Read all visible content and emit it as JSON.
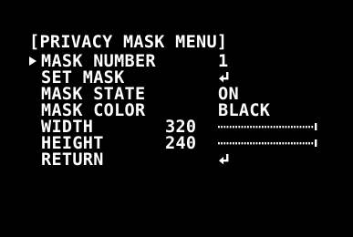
{
  "menu": {
    "title": "[PRIVACY MASK MENU]",
    "cursor_icon": "right-triangle-icon",
    "items": [
      {
        "label": "MASK NUMBER",
        "value": "1"
      },
      {
        "label": "SET MASK",
        "icon": "enter-return-icon"
      },
      {
        "label": "MASK STATE",
        "value": "ON"
      },
      {
        "label": "MASK COLOR",
        "value": "BLACK"
      },
      {
        "label": "WIDTH",
        "number": "320",
        "level": 1.0
      },
      {
        "label": "HEIGHT",
        "number": "240",
        "level": 1.0
      },
      {
        "label": "RETURN",
        "icon": "enter-return-icon"
      }
    ]
  },
  "colors": {
    "background": "#000000",
    "text": "#ffffff"
  }
}
